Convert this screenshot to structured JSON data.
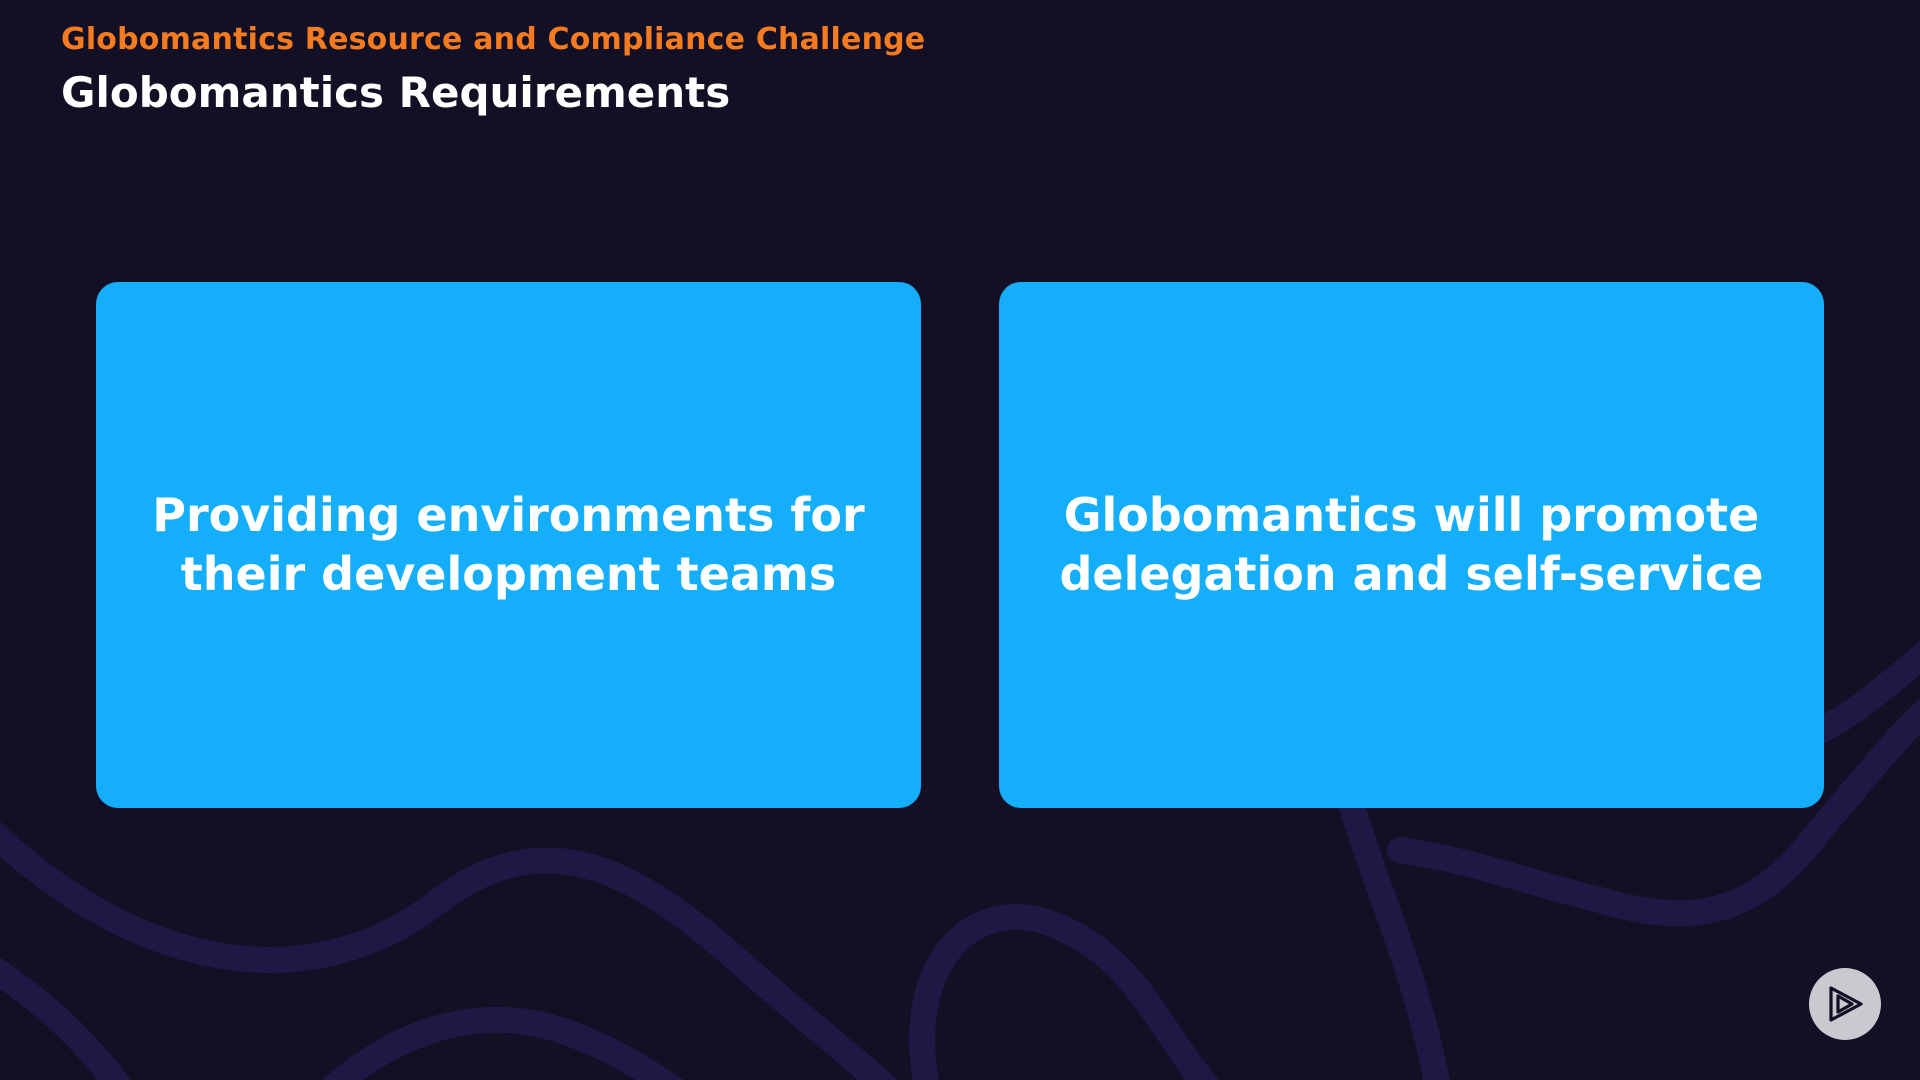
{
  "header": {
    "kicker": "Globomantics Resource and Compliance Challenge",
    "title": "Globomantics Requirements"
  },
  "cards": [
    {
      "text": "Providing environments for their development teams"
    },
    {
      "text": "Globomantics will promote delegation and self-service"
    }
  ],
  "colors": {
    "background": "#130f25",
    "accent_orange": "#f47b20",
    "card_blue": "#14aefa",
    "decor_lines": "#1f1a45"
  },
  "icons": {
    "brand_badge": "play-logo-icon"
  }
}
